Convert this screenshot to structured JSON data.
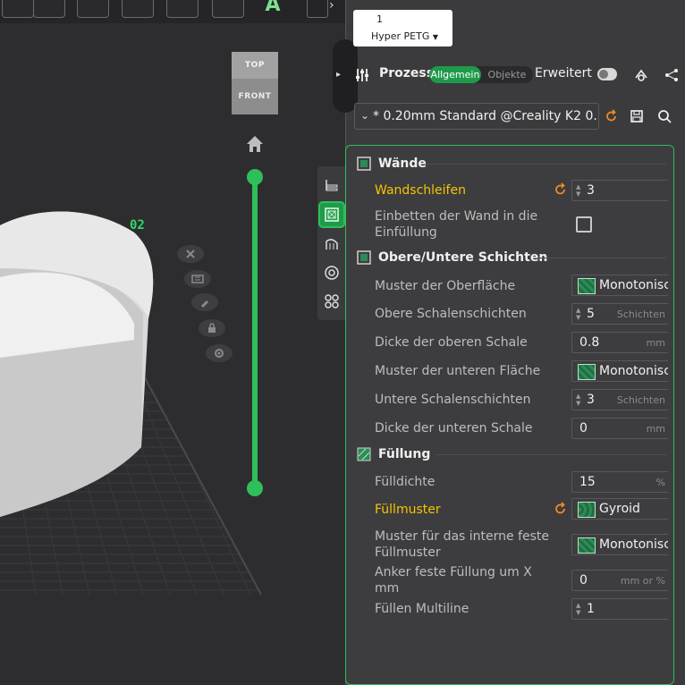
{
  "viewport": {
    "viewcube": {
      "top_label": "TOP",
      "front_label": "FRONT"
    },
    "layer_label": "02"
  },
  "filament": {
    "number": "1",
    "name": "Hyper PETG"
  },
  "process": {
    "title": "Prozess",
    "tab_global": "Allgemein",
    "tab_objects": "Objekte",
    "advanced_label": "Erweitert",
    "preset": "* 0.20mm Standard @Creality K2 0..."
  },
  "sections": {
    "walls": {
      "title": "Wände",
      "wall_loops_label": "Wandschleifen",
      "wall_loops_value": "3",
      "embed_wall_label": "Einbetten der Wand in die Einfüllung"
    },
    "top_bottom": {
      "title": "Obere/Untere Schichten",
      "top_pattern_label": "Muster der Oberfläche",
      "top_pattern_value": "Monotonisch",
      "top_shells_label": "Obere Schalenschichten",
      "top_shells_value": "5",
      "top_shells_unit": "Schichten",
      "top_thickness_label": "Dicke der oberen Schale",
      "top_thickness_value": "0.8",
      "top_thickness_unit": "mm",
      "bottom_pattern_label": "Muster der unteren Fläche",
      "bottom_pattern_value": "Monotonisch",
      "bottom_shells_label": "Untere Schalenschichten",
      "bottom_shells_value": "3",
      "bottom_shells_unit": "Schichten",
      "bottom_thickness_label": "Dicke der unteren Schale",
      "bottom_thickness_value": "0",
      "bottom_thickness_unit": "mm"
    },
    "infill": {
      "title": "Füllung",
      "density_label": "Fülldichte",
      "density_value": "15",
      "density_unit": "%",
      "pattern_label": "Füllmuster",
      "pattern_value": "Gyroid",
      "internal_solid_label": "Muster für das interne feste Füllmuster",
      "internal_solid_value": "Monotonisch",
      "anchor_label": "Anker feste Füllung um X mm",
      "anchor_value": "0",
      "anchor_unit": "mm or %",
      "multiline_label": "Füllen Multiline",
      "multiline_value": "1"
    }
  },
  "colors": {
    "accent": "#2fbf5a",
    "changed": "#f5c400",
    "reset": "#f08a24",
    "panel_bg": "#3b3b3d",
    "viewport_bg": "#2d2d30"
  }
}
